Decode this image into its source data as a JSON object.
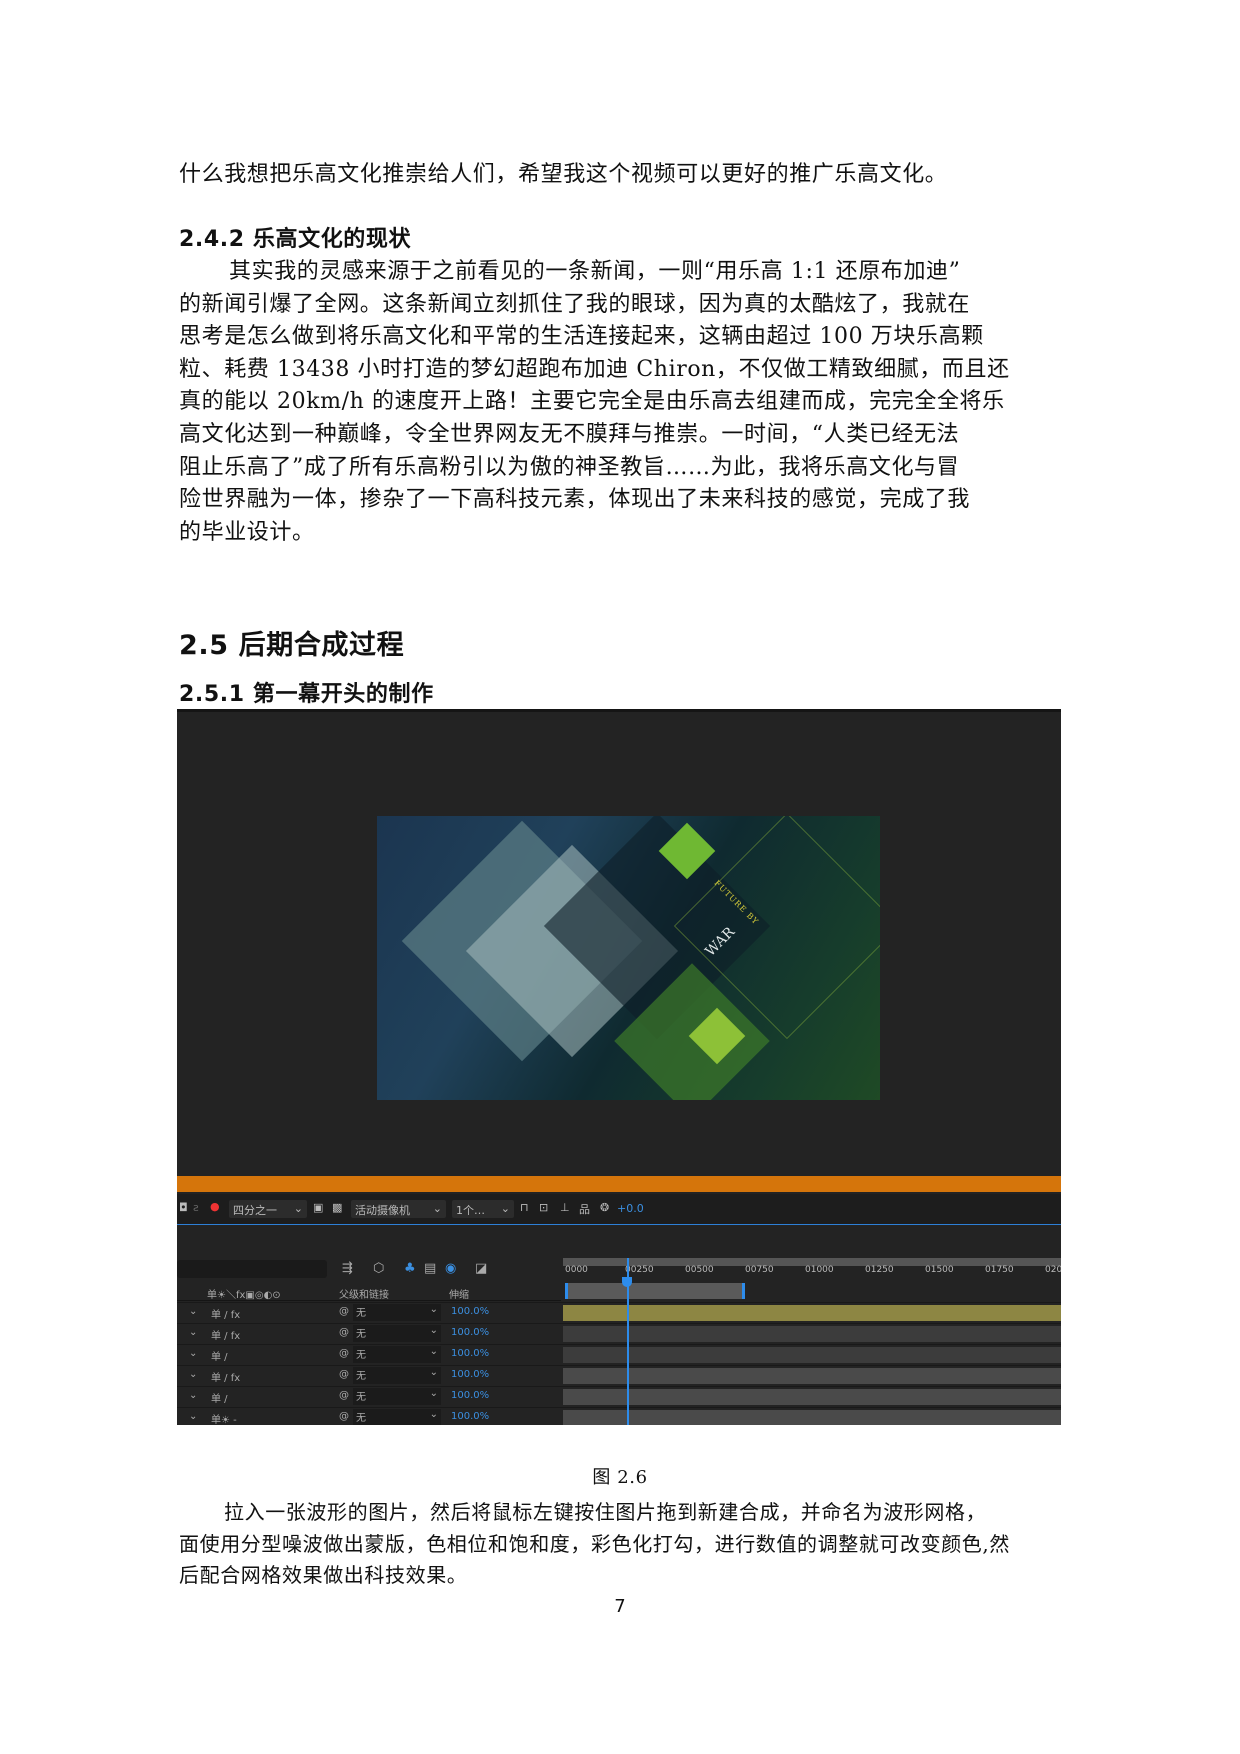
{
  "paragraph_top": "什么我想把乐高文化推崇给人们，希望我这个视频可以更好的推广乐高文化。",
  "section_242": {
    "heading": "2.4.2 乐高文化的现状",
    "lines": [
      "其实我的灵感来源于之前看见的一条新闻，一则“用乐高 1:1 还原布加迪”",
      "的新闻引爆了全网。这条新闻立刻抓住了我的眼球，因为真的太酷炫了，我就在",
      "思考是怎么做到将乐高文化和平常的生活连接起来，这辆由超过 100 万块乐高颗",
      "粒、耗费 13438 小时打造的梦幻超跑布加迪 Chiron，不仅做工精致细腻，而且还",
      "真的能以 20km/h 的速度开上路！主要它完全是由乐高去组建而成，完完全全将乐",
      "高文化达到一种巅峰，令全世界网友无不膜拜与推崇。一时间，“人类已经无法",
      "阻止乐高了”成了所有乐高粉引以为傲的神圣教旨……为此，我将乐高文化与冒",
      "险世界融为一体，掺杂了一下高科技元素，体现出了未来科技的感觉，完成了我",
      "的毕业设计。"
    ]
  },
  "section_25": {
    "heading": "2.5 后期合成过程"
  },
  "section_251": {
    "heading": "2.5.1 第一幕开头的制作"
  },
  "screenshot": {
    "preview_text": {
      "small": "FUTURE BY",
      "large": "WAR"
    },
    "toolbar": {
      "resolution": "四分之一",
      "camera": "活动摄像机",
      "views": "1个…",
      "exposure": "+0.0"
    },
    "columns": {
      "switches": "单☀＼fx▣◎◐⊙",
      "parent": "父级和链接",
      "stretch": "伸缩"
    },
    "ruler": [
      "0000",
      "00250",
      "00500",
      "00750",
      "01000",
      "01250",
      "01500",
      "01750",
      "02000"
    ],
    "rows": [
      {
        "switches": "单 / fx",
        "parent": "无",
        "stretch": "100.0%",
        "bar_color": "#8d8643"
      },
      {
        "switches": "单 / fx",
        "parent": "无",
        "stretch": "100.0%",
        "bar_color": "#3c3c3c"
      },
      {
        "switches": "单 /",
        "parent": "无",
        "stretch": "100.0%",
        "bar_color": "#3c3c3c"
      },
      {
        "switches": "单 / fx",
        "parent": "无",
        "stretch": "100.0%",
        "bar_color": "#4a4a4a"
      },
      {
        "switches": "单 /",
        "parent": "无",
        "stretch": "100.0%",
        "bar_color": "#4a4a4a"
      },
      {
        "switches": "单☀ -",
        "parent": "无",
        "stretch": "100.0%",
        "bar_color": "#4a4a4a"
      }
    ],
    "colors": {
      "accent_orange": "#d5750b",
      "playhead_blue": "#2d8ceb",
      "stretch_blue": "#3b8fe0"
    }
  },
  "caption": "图 2.6",
  "paragraph_bottom": [
    "拉入一张波形的图片，然后将鼠标左键按住图片拖到新建合成，并命名为波形网格，",
    "面使用分型噪波做出蒙版，色相位和饱和度，彩色化打勾，进行数值的调整就可改变颜色,然",
    "后配合网格效果做出科技效果。"
  ],
  "page_number": "7"
}
